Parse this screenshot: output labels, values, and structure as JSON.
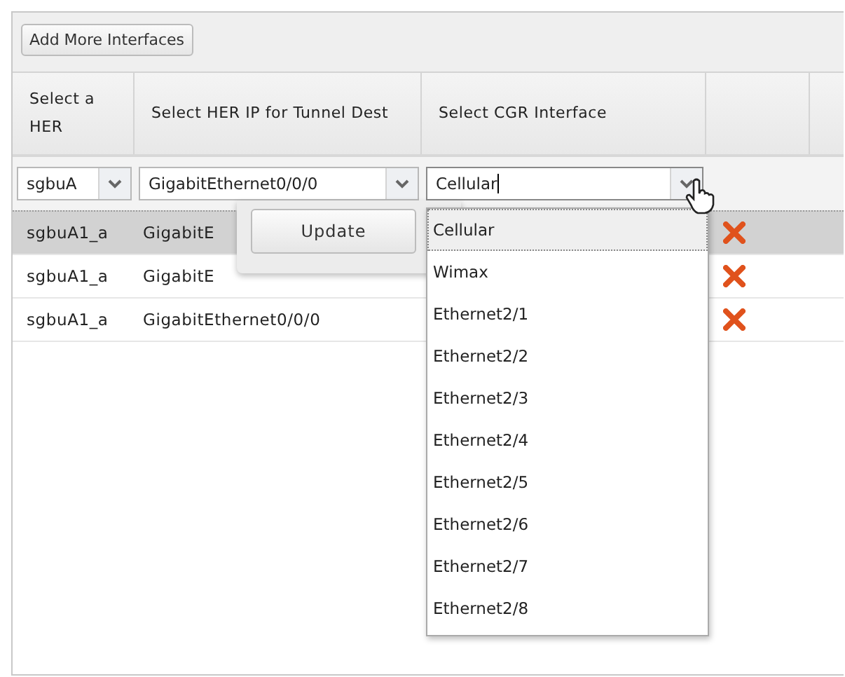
{
  "toolbar": {
    "add_button": "Add More Interfaces"
  },
  "columns": [
    "Select a HER",
    "Select HER IP for Tunnel Dest",
    "Select CGR Interface"
  ],
  "editor": {
    "her": "sgbuA",
    "her_ip": "GigabitEthernet0/0/0",
    "cgr_interface": "Cellular"
  },
  "rows": [
    {
      "her": "sgbuA1_a",
      "her_ip": "GigabitE",
      "selected": true
    },
    {
      "her": "sgbuA1_a",
      "her_ip": "GigabitE",
      "selected": false
    },
    {
      "her": "sgbuA1_a",
      "her_ip": "GigabitEthernet0/0/0",
      "selected": false
    }
  ],
  "update_button": "Update",
  "dropdown": {
    "options": [
      {
        "label": "Cellular",
        "selected": true
      },
      {
        "label": "Wimax",
        "selected": false
      },
      {
        "label": "Ethernet2/1",
        "selected": false
      },
      {
        "label": "Ethernet2/2",
        "selected": false
      },
      {
        "label": "Ethernet2/3",
        "selected": false
      },
      {
        "label": "Ethernet2/4",
        "selected": false
      },
      {
        "label": "Ethernet2/5",
        "selected": false
      },
      {
        "label": "Ethernet2/6",
        "selected": false
      },
      {
        "label": "Ethernet2/7",
        "selected": false
      },
      {
        "label": "Ethernet2/8",
        "selected": false
      }
    ]
  }
}
